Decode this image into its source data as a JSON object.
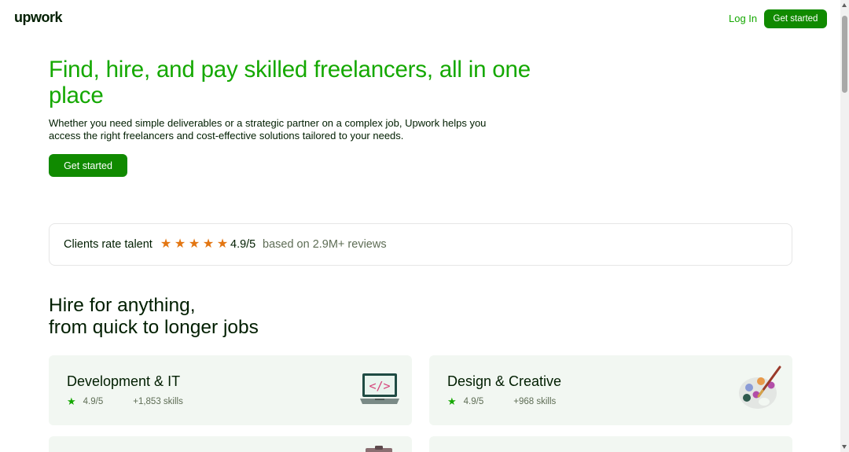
{
  "header": {
    "logo": "upwork",
    "login_label": "Log In",
    "cta_label": "Get started"
  },
  "hero": {
    "title": "Find, hire, and pay skilled freelancers, all in one place",
    "subtitle": "Whether you need simple deliverables or a strategic partner on a complex job, Upwork helps you access the right freelancers and cost-effective solutions tailored to your needs.",
    "cta_label": "Get started"
  },
  "rating": {
    "label": "Clients rate talent",
    "stars": 5,
    "score": "4.9/5",
    "based_on": "based on 2.9M+ reviews"
  },
  "section": {
    "title_line1": "Hire for anything,",
    "title_line2": "from quick to longer jobs"
  },
  "categories": [
    {
      "title": "Development & IT",
      "rating": "4.9/5",
      "skills": "+1,853 skills",
      "icon": "laptop-code-icon"
    },
    {
      "title": "Design & Creative",
      "rating": "4.9/5",
      "skills": "+968 skills",
      "icon": "paint-palette-icon"
    }
  ],
  "colors": {
    "brand_green": "#14a800",
    "button_green": "#108a00",
    "card_bg": "#f2f7f2",
    "star_orange": "#e37612"
  }
}
